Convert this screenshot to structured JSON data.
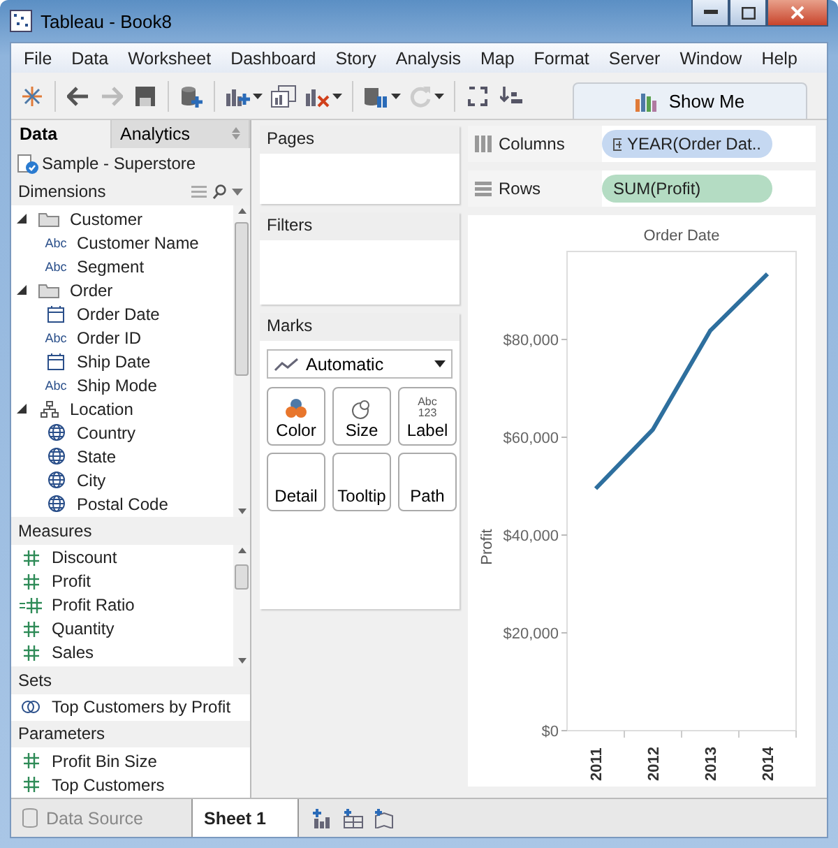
{
  "window": {
    "title": "Tableau - Book8"
  },
  "menu": [
    "File",
    "Data",
    "Worksheet",
    "Dashboard",
    "Story",
    "Analysis",
    "Map",
    "Format",
    "Server",
    "Window",
    "Help"
  ],
  "show_me": {
    "label": "Show Me"
  },
  "side_tabs": [
    {
      "label": "Data",
      "selected": true
    },
    {
      "label": "Analytics",
      "selected": false
    }
  ],
  "data_source": "Sample - Superstore",
  "dimensions": {
    "title": "Dimensions",
    "items": [
      {
        "label": "Customer",
        "kind": "folder",
        "expanded": true,
        "children": [
          {
            "label": "Customer Name",
            "kind": "string",
            "tag": "Abc"
          },
          {
            "label": "Segment",
            "kind": "string",
            "tag": "Abc"
          }
        ]
      },
      {
        "label": "Order",
        "kind": "folder",
        "expanded": true,
        "children": [
          {
            "label": "Order Date",
            "kind": "date"
          },
          {
            "label": "Order ID",
            "kind": "string",
            "tag": "Abc"
          },
          {
            "label": "Ship Date",
            "kind": "date"
          },
          {
            "label": "Ship Mode",
            "kind": "string",
            "tag": "Abc"
          }
        ]
      },
      {
        "label": "Location",
        "kind": "hierarchy",
        "expanded": true,
        "children": [
          {
            "label": "Country",
            "kind": "geo"
          },
          {
            "label": "State",
            "kind": "geo"
          },
          {
            "label": "City",
            "kind": "geo"
          },
          {
            "label": "Postal Code",
            "kind": "geo"
          }
        ]
      }
    ]
  },
  "measures": {
    "title": "Measures",
    "items": [
      {
        "label": "Discount",
        "kind": "measure"
      },
      {
        "label": "Profit",
        "kind": "measure"
      },
      {
        "label": "Profit Ratio",
        "kind": "calc"
      },
      {
        "label": "Quantity",
        "kind": "measure"
      },
      {
        "label": "Sales",
        "kind": "measure"
      }
    ]
  },
  "sets": {
    "title": "Sets",
    "items": [
      {
        "label": "Top Customers by Profit",
        "kind": "set"
      }
    ]
  },
  "parameters": {
    "title": "Parameters",
    "items": [
      {
        "label": "Profit Bin Size",
        "kind": "measure"
      },
      {
        "label": "Top Customers",
        "kind": "measure"
      }
    ]
  },
  "pages": {
    "title": "Pages"
  },
  "filters": {
    "title": "Filters"
  },
  "marks": {
    "title": "Marks",
    "type": "Automatic",
    "buttons": [
      {
        "label": "Color",
        "kind": "color"
      },
      {
        "label": "Size",
        "kind": "size"
      },
      {
        "label": "Label",
        "kind": "label",
        "tag": [
          "Abc",
          "123"
        ]
      },
      {
        "label": "Detail",
        "kind": "plain"
      },
      {
        "label": "Tooltip",
        "kind": "plain"
      },
      {
        "label": "Path",
        "kind": "plain"
      }
    ]
  },
  "shelves": [
    {
      "label": "Columns",
      "kind": "columns",
      "pill": "YEAR(Order Dat..",
      "color": "#c5d8f1"
    },
    {
      "label": "Rows",
      "kind": "rows",
      "pill": "SUM(Profit)",
      "color": "#b4dcc3"
    }
  ],
  "view": {
    "header": "Order Date",
    "chart_data": {
      "type": "line",
      "ylabel": "Profit",
      "categories": [
        "2011",
        "2012",
        "2013",
        "2014"
      ],
      "series": [
        {
          "color": "#2e6f9e",
          "values": [
            49500,
            61600,
            81800,
            93400
          ]
        }
      ],
      "ylim": [
        0,
        98000
      ],
      "yticks": [
        {
          "value": 0,
          "label": "$0"
        },
        {
          "value": 20000,
          "label": "$20,000"
        },
        {
          "value": 40000,
          "label": "$40,000"
        },
        {
          "value": 60000,
          "label": "$60,000"
        },
        {
          "value": 80000,
          "label": "$80,000"
        }
      ]
    }
  },
  "bottom_tabs": [
    {
      "label": "Data Source",
      "kind": "source",
      "selected": false
    },
    {
      "label": "Sheet 1",
      "kind": "sheet",
      "selected": true
    }
  ]
}
